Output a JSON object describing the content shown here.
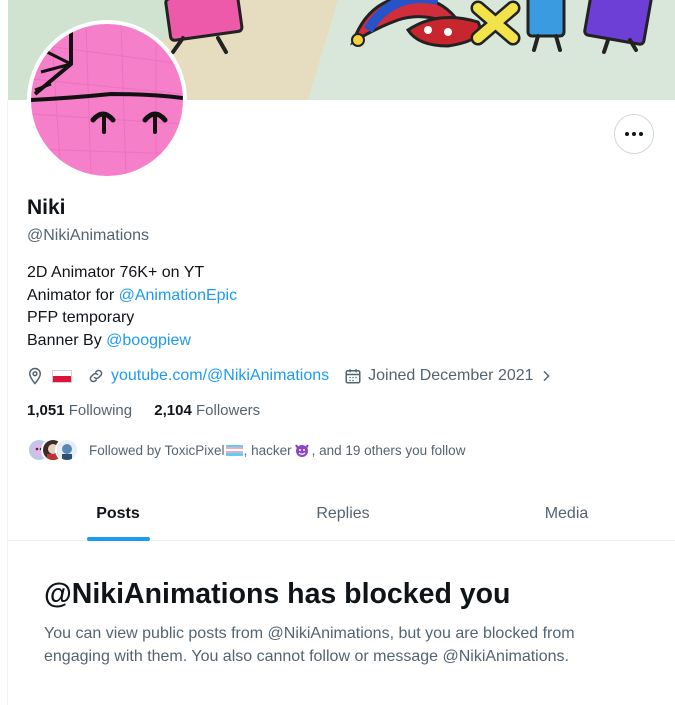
{
  "profile": {
    "name": "Niki",
    "handle": "@NikiAnimations",
    "bio": {
      "line1": "2D Animator 76K+ on YT",
      "line2_prefix": "Animator for ",
      "line2_mention": "@AnimationEpic",
      "line3": "PFP temporary",
      "line4_prefix": "Banner By ",
      "line4_mention": "@boogpiew"
    },
    "location_flag": "poland-flag",
    "website": "youtube.com/@NikiAnimations",
    "joined": "Joined December 2021",
    "following_count": "1,051",
    "following_label": "Following",
    "followers_count": "2,104",
    "followers_label": "Followers"
  },
  "followed_by": {
    "prefix": "Followed by ToxicPixel",
    "middle": ", hacker ",
    "suffix": ", and 19 others you follow"
  },
  "tabs": [
    {
      "label": "Posts",
      "active": true
    },
    {
      "label": "Replies",
      "active": false
    },
    {
      "label": "Media",
      "active": false
    }
  ],
  "blocked": {
    "title": "@NikiAnimations has blocked you",
    "description": "You can view public posts from @NikiAnimations, but you are blocked from engaging with them. You also cannot follow or message @NikiAnimations."
  },
  "icons": {
    "more": "more-horizontal-icon",
    "location": "location-pin-icon",
    "link": "link-icon",
    "calendar": "calendar-icon",
    "chevron": "chevron-right-icon"
  },
  "colors": {
    "accent": "#1d9bf0",
    "text_primary": "#0f1419",
    "text_secondary": "#536471",
    "avatar_pink": "#f57fc9"
  }
}
